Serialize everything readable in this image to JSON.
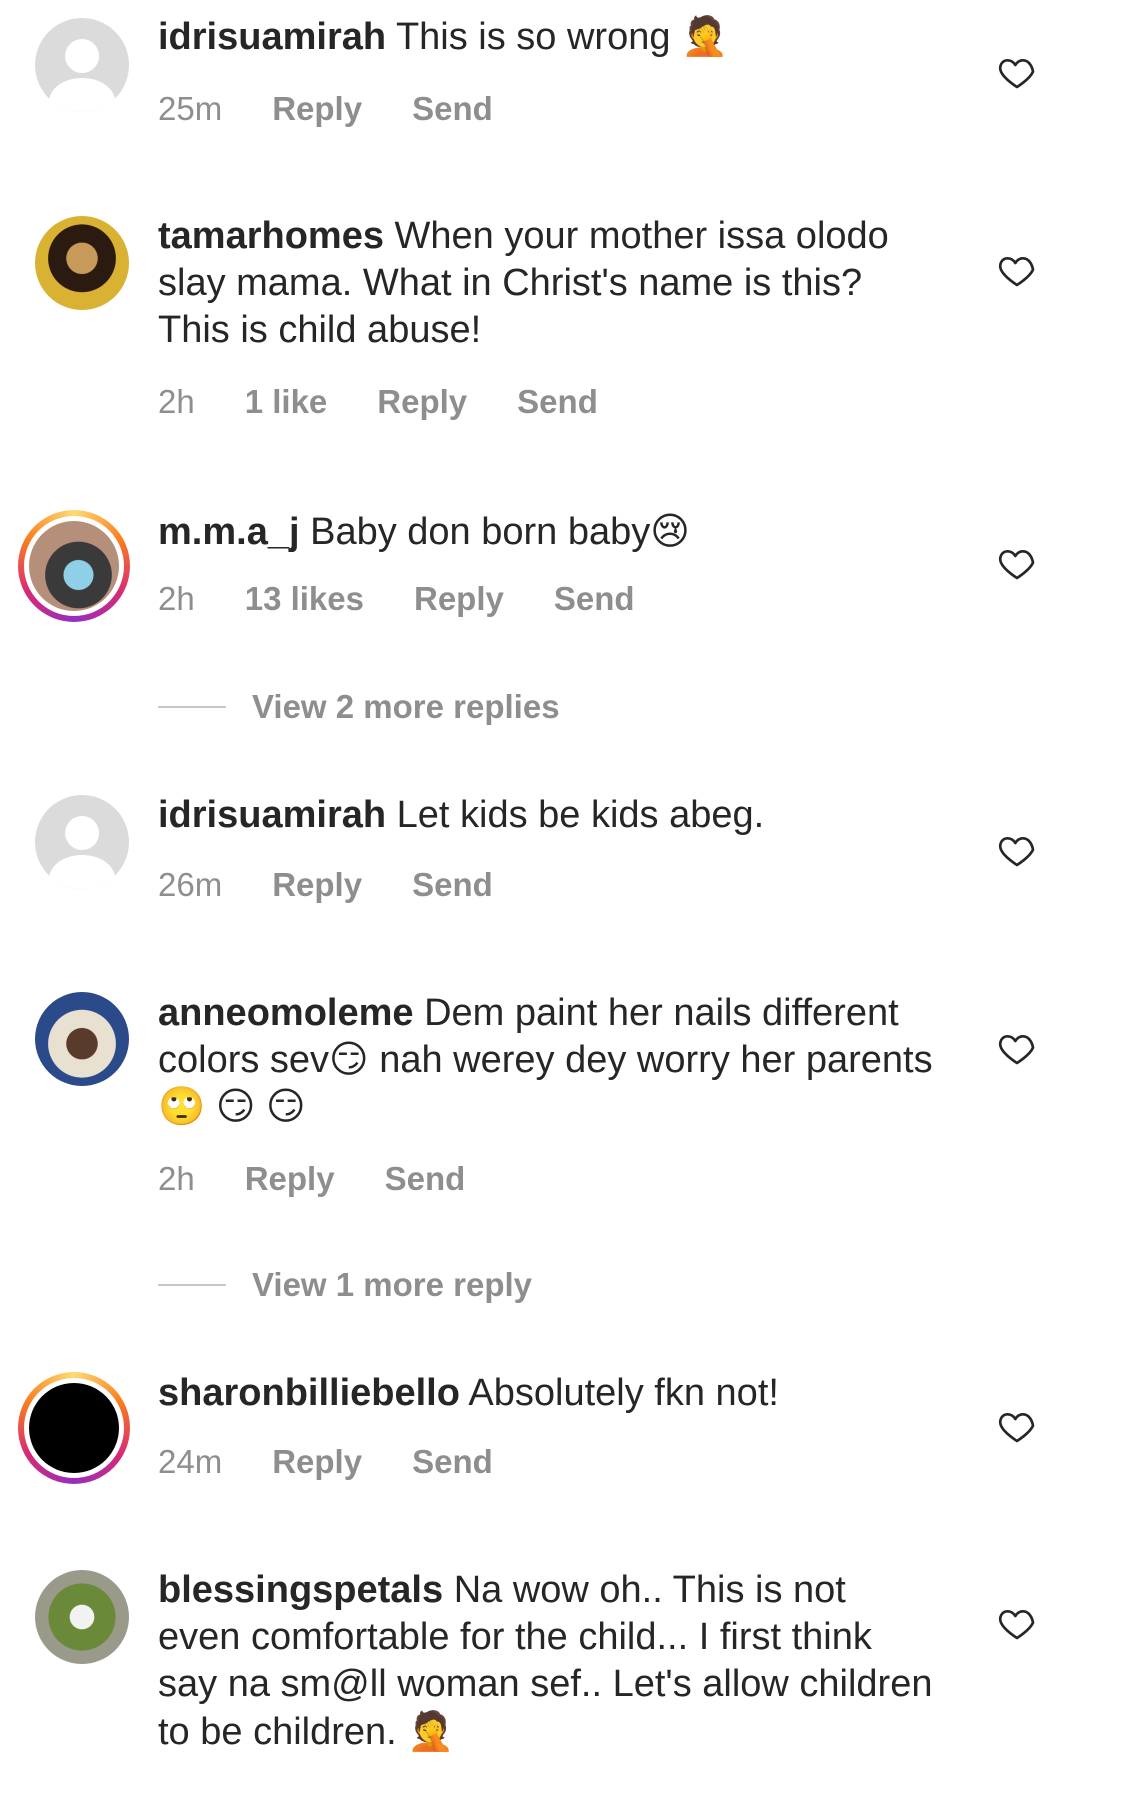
{
  "comments": [
    {
      "username": "idrisuamirah",
      "text": "This is so wrong",
      "emoji": "🤦",
      "time": "25m",
      "likes": "",
      "reply": "Reply",
      "send": "Send"
    },
    {
      "username": "tamarhomes",
      "text": "When your mother issa olodo slay mama. What in Christ's name is this? This is child abuse!",
      "emoji": "",
      "time": "2h",
      "likes": "1 like",
      "reply": "Reply",
      "send": "Send"
    },
    {
      "username": "m.m.a_j",
      "text": "Baby don born baby",
      "emoji": "😢",
      "time": "2h",
      "likes": "13 likes",
      "reply": "Reply",
      "send": "Send",
      "view_more": "View 2 more replies"
    },
    {
      "username": "idrisuamirah",
      "text": "Let kids be kids abeg.",
      "emoji": "",
      "time": "26m",
      "likes": "",
      "reply": "Reply",
      "send": "Send"
    },
    {
      "username": "anneomoleme",
      "text": "Dem paint her nails different colors sev😏 nah werey dey worry her parents 🙄 😏 😏",
      "emoji": "",
      "time": "2h",
      "likes": "",
      "reply": "Reply",
      "send": "Send",
      "view_more": "View 1 more reply"
    },
    {
      "username": "sharonbilliebello",
      "text": "Absolutely fkn not!",
      "emoji": "",
      "time": "24m",
      "likes": "",
      "reply": "Reply",
      "send": "Send"
    },
    {
      "username": "blessingspetals",
      "text": "Na wow oh.. This is not even comfortable for the child... I first think say na sm@ll woman sef.. Let's allow children to be children.",
      "emoji": "🤦",
      "time": "",
      "likes": "",
      "reply": "",
      "send": ""
    }
  ],
  "icons": {
    "heart": "heart-outline-icon",
    "default_avatar": "default-profile-icon"
  },
  "colors": {
    "text": "#262626",
    "meta": "#8e8e8e",
    "story_ring_start": "#feda75",
    "story_ring_end": "#d62976"
  }
}
